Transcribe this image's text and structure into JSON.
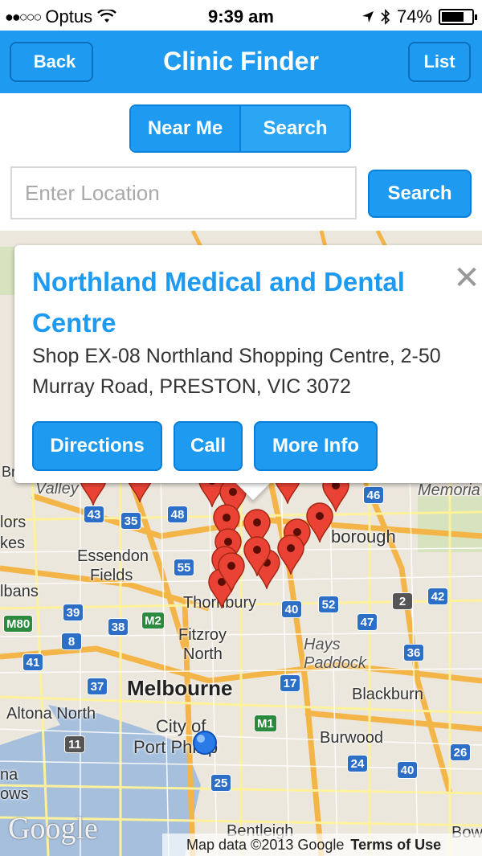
{
  "status_bar": {
    "carrier": "Optus",
    "time": "9:39 am",
    "battery": "74%",
    "battery_level": 0.74,
    "icons": [
      "signal-dots-icon",
      "wifi-icon",
      "location-arrow-icon",
      "bluetooth-icon",
      "battery-icon"
    ]
  },
  "nav": {
    "title": "Clinic Finder",
    "back_label": "Back",
    "list_label": "List"
  },
  "segment": {
    "options": [
      "Near Me",
      "Search"
    ]
  },
  "search": {
    "placeholder": "Enter Location",
    "value": "",
    "button_label": "Search"
  },
  "callout": {
    "title": "Northland Medical and Dental Centre",
    "address": "Shop EX-08 Northland Shopping Centre, 2-50 Murray Road, PRESTON, VIC 3072",
    "buttons": {
      "directions": "Directions",
      "call": "Call",
      "more_info": "More Info"
    },
    "close_glyph": "✕"
  },
  "map": {
    "labels": {
      "valley": "Valley",
      "memoria": "Memoria",
      "lors": "lors",
      "kes": "kes",
      "essendon": "Essendon",
      "fields": "Fields",
      "borough": "borough",
      "lbans": "lbans",
      "thornbury": "Thornbury",
      "fitzroy": "Fitzroy",
      "north": "North",
      "hays": "Hays",
      "paddock": "Paddock",
      "melbourne": "Melbourne",
      "blackburn": "Blackburn",
      "altona_north": "Altona North",
      "city_of": "City of",
      "port_phillip": "Port Phillip",
      "burwood": "Burwood",
      "bentleigh": "Bentleigh",
      "bow": "Bow",
      "br": "Br",
      "na": "na",
      "ows": "ows"
    },
    "shields": [
      "46",
      "48",
      "35",
      "43",
      "55",
      "39",
      "38",
      "M2",
      "M80",
      "8",
      "41",
      "37",
      "17",
      "M1",
      "11",
      "52",
      "47",
      "40",
      "2",
      "42",
      "36",
      "24",
      "40",
      "26",
      "25"
    ],
    "pin_count": 18,
    "google_logo": "Google",
    "attribution": "Map data ©2013 Google",
    "terms": "Terms of Use"
  }
}
